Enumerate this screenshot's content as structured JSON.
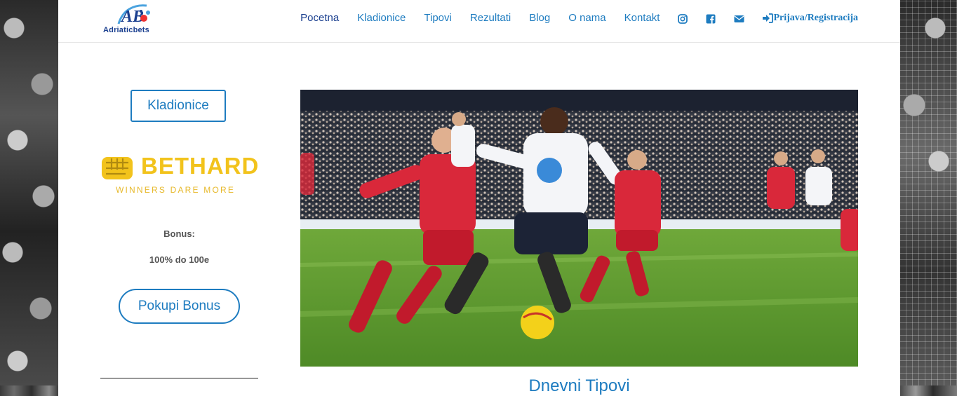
{
  "brand": {
    "logo_text_1": "Adriatic",
    "logo_text_2": "bets",
    "logo_mark": "AB"
  },
  "nav": {
    "items": [
      {
        "label": "Pocetna",
        "active": true
      },
      {
        "label": "Kladionice"
      },
      {
        "label": "Tipovi"
      },
      {
        "label": "Rezultati"
      },
      {
        "label": "Blog"
      },
      {
        "label": "O nama"
      },
      {
        "label": "Kontakt"
      }
    ],
    "icons": [
      "instagram-icon",
      "facebook-icon",
      "envelope-icon"
    ],
    "login_label": "Prijava/Registracija",
    "login_icon": "sign-in-icon"
  },
  "sidebar": {
    "kladionice_label": "Kladionice",
    "bookmaker": {
      "name": "BETHARD",
      "tagline": "WINNERS DARE MORE",
      "icon": "fist-icon"
    },
    "bonus_label": "Bonus:",
    "bonus_value": "100% do 100e",
    "claim_label": "Pokupi Bonus"
  },
  "main": {
    "section_title": "Dnevni Tipovi"
  },
  "colors": {
    "accent": "#1e7cc0",
    "active_nav": "#1a3f8f",
    "bethard": "#f2c31c"
  }
}
